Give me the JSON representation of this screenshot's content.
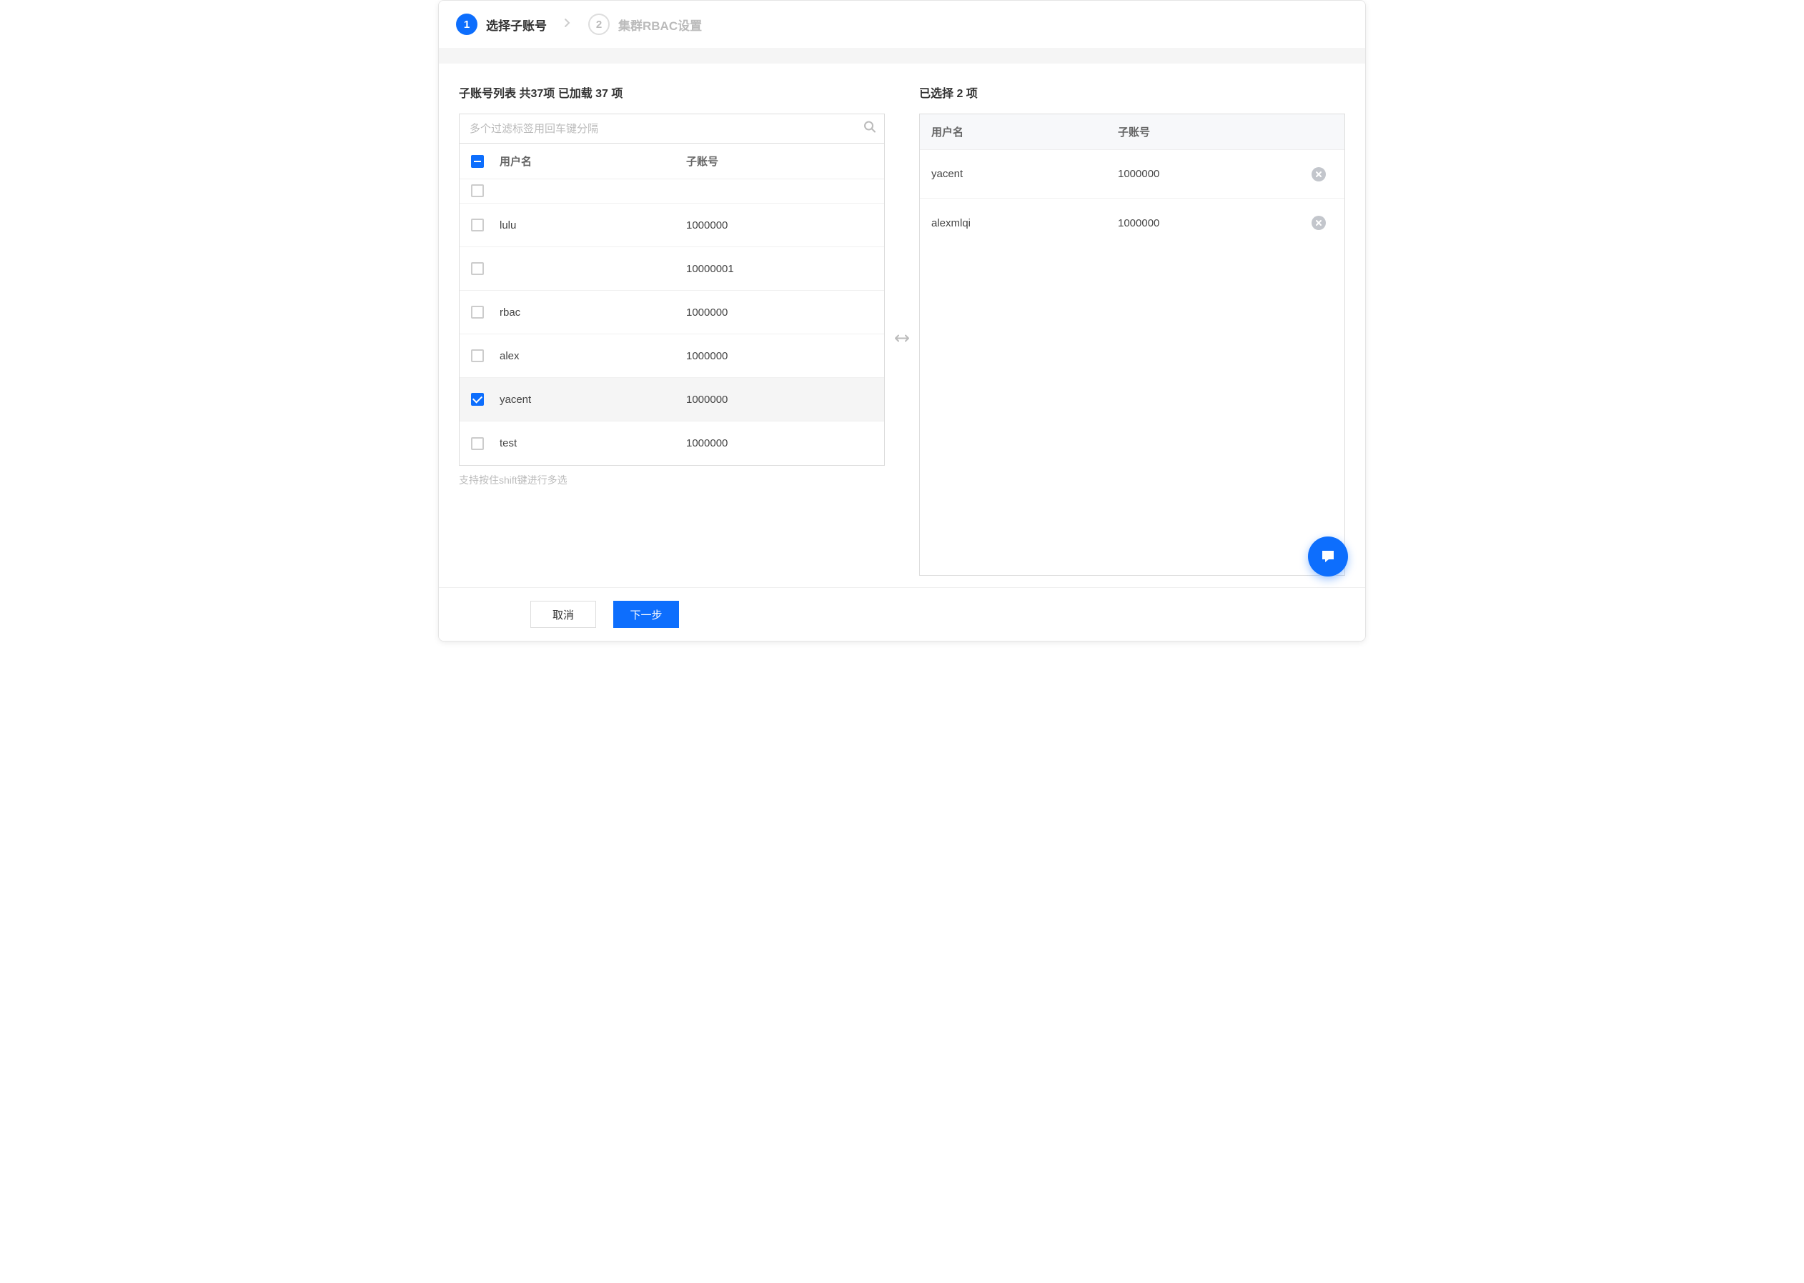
{
  "steps": {
    "s1": {
      "num": "1",
      "label": "选择子账号"
    },
    "s2": {
      "num": "2",
      "label": "集群RBAC设置"
    }
  },
  "left": {
    "title": "子账号列表 共37项 已加载 37 项",
    "search_placeholder": "多个过滤标签用回车键分隔",
    "col_user": "用户名",
    "col_acct": "子账号",
    "rows": [
      {
        "user": "",
        "acct": ""
      },
      {
        "user": "lulu",
        "acct": "1000000"
      },
      {
        "user": "",
        "acct": "10000001"
      },
      {
        "user": "rbac",
        "acct": "1000000"
      },
      {
        "user": "alex",
        "acct": "1000000"
      },
      {
        "user": "yacent",
        "acct": "1000000"
      },
      {
        "user": "test",
        "acct": "1000000"
      }
    ],
    "hint": "支持按住shift键进行多选"
  },
  "right": {
    "title": "已选择 2 项",
    "col_user": "用户名",
    "col_acct": "子账号",
    "rows": [
      {
        "user": "yacent",
        "acct": "1000000"
      },
      {
        "user": "alexmlqi",
        "acct": "1000000"
      }
    ]
  },
  "footer": {
    "cancel": "取消",
    "next": "下一步"
  }
}
